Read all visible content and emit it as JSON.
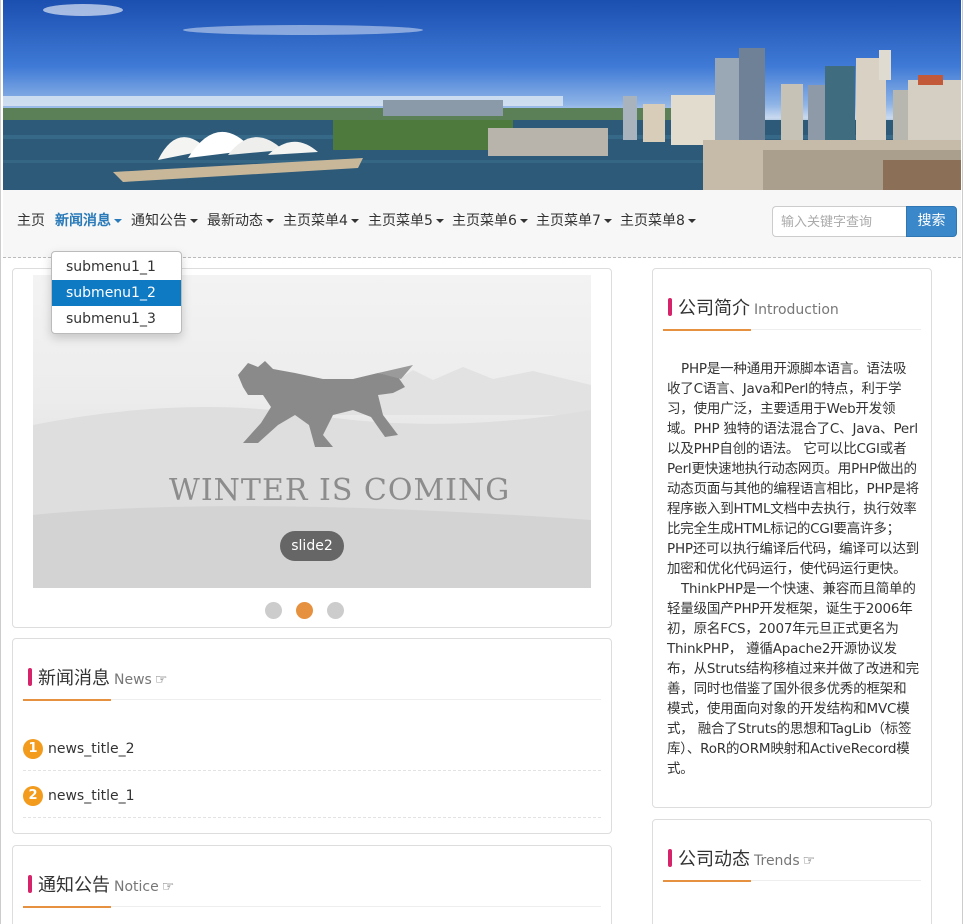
{
  "nav": {
    "items": [
      {
        "label": "主页",
        "has_caret": false
      },
      {
        "label": "新闻消息",
        "has_caret": true,
        "active": true
      },
      {
        "label": "通知公告",
        "has_caret": true
      },
      {
        "label": "最新动态",
        "has_caret": true
      },
      {
        "label": "主页菜单4",
        "has_caret": true
      },
      {
        "label": "主页菜单5",
        "has_caret": true
      },
      {
        "label": "主页菜单6",
        "has_caret": true
      },
      {
        "label": "主页菜单7",
        "has_caret": true
      },
      {
        "label": "主页菜单8",
        "has_caret": true
      }
    ],
    "search_placeholder": "输入关键字查询",
    "search_button": "搜索",
    "dropdown": [
      "submenu1_1",
      "submenu1_2",
      "submenu1_3"
    ]
  },
  "slider": {
    "caption": "slide2",
    "image_text": "WINTER IS COMING",
    "current_slide": 2,
    "total_slides": 3
  },
  "news": {
    "title": "新闻消息",
    "subtitle": "News",
    "items": [
      {
        "num": "1",
        "title": "news_title_2"
      },
      {
        "num": "2",
        "title": "news_title_1"
      }
    ]
  },
  "notice": {
    "title": "通知公告",
    "subtitle": "Notice"
  },
  "intro": {
    "title": "公司简介",
    "subtitle": "Introduction",
    "para1": "PHP是一种通用开源脚本语言。语法吸收了C语言、Java和Perl的特点，利于学习，使用广泛，主要适用于Web开发领域。PHP 独特的语法混合了C、Java、Perl以及PHP自创的语法。 它可以比CGI或者Perl更快速地执行动态网页。用PHP做出的动态页面与其他的编程语言相比，PHP是将程序嵌入到HTML文档中去执行，执行效率比完全生成HTML标记的CGI要高许多； PHP还可以执行编译后代码，编译可以达到加密和优化代码运行，使代码运行更快。",
    "para2": "ThinkPHP是一个快速、兼容而且简单的轻量级国产PHP开发框架，诞生于2006年初，原名FCS，2007年元旦正式更名为ThinkPHP， 遵循Apache2开源协议发布，从Struts结构移植过来并做了改进和完善，同时也借鉴了国外很多优秀的框架和模式，使用面向对象的开发结构和MVC模式， 融合了Struts的思想和TagLib（标签库）、RoR的ORM映射和ActiveRecord模式。"
  },
  "trends": {
    "title": "公司动态",
    "subtitle": "Trends"
  },
  "colors": {
    "accent_blue": "#2a7ab9",
    "accent_orange": "#e6913f",
    "bar_pink": "#d6246b",
    "number_badge": "#f29b1d"
  },
  "icons": {
    "hand_pointer": "pointing-hand-icon"
  }
}
